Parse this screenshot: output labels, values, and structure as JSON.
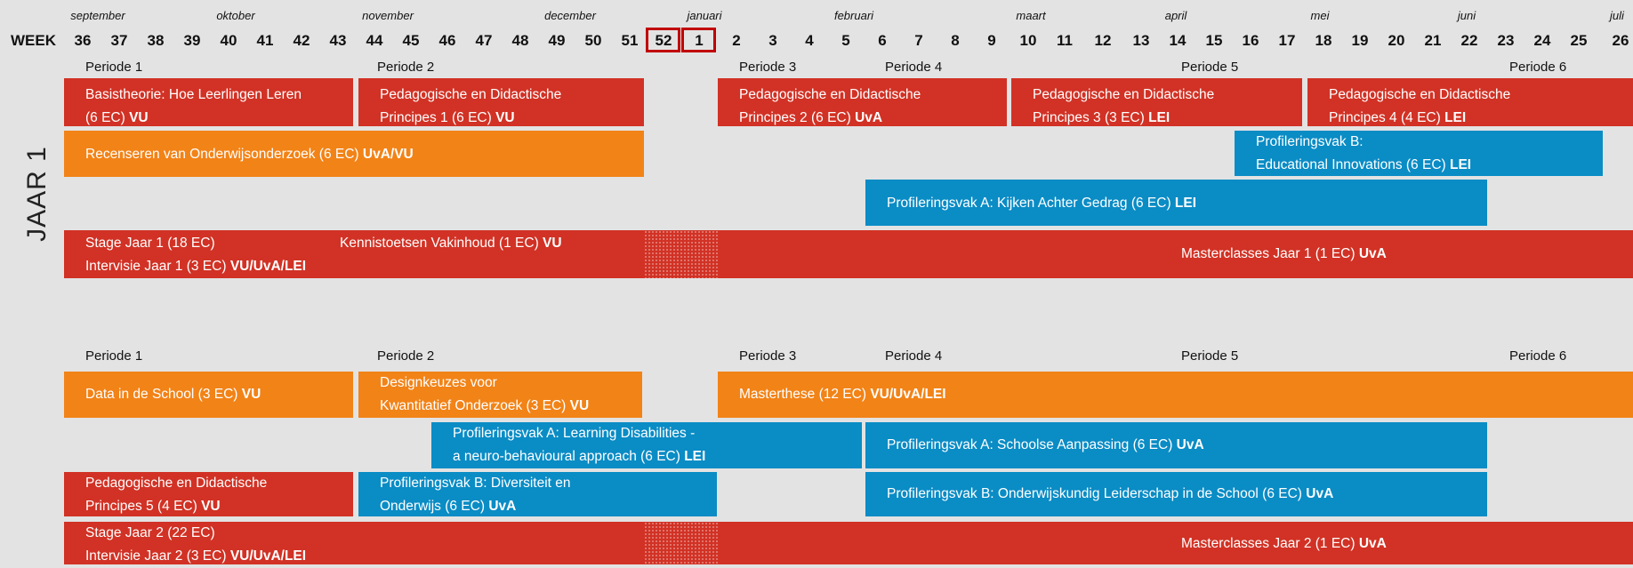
{
  "header": {
    "week_label": "WEEK",
    "months": [
      "september",
      "oktober",
      "november",
      "december",
      "januari",
      "februari",
      "maart",
      "april",
      "mei",
      "juni",
      "juli"
    ],
    "weeks": [
      "36",
      "37",
      "38",
      "39",
      "40",
      "41",
      "42",
      "43",
      "44",
      "45",
      "46",
      "47",
      "48",
      "49",
      "50",
      "51",
      "52",
      "1",
      "2",
      "3",
      "4",
      "5",
      "6",
      "7",
      "8",
      "9",
      "10",
      "11",
      "12",
      "13",
      "14",
      "15",
      "16",
      "17",
      "18",
      "19",
      "20",
      "21",
      "22",
      "23",
      "24",
      "25",
      "26"
    ],
    "highlighted_weeks": [
      "52",
      "1"
    ]
  },
  "year1": {
    "label": "JAAR 1",
    "periods": [
      "Periode 1",
      "Periode 2",
      "Periode 3",
      "Periode 4",
      "Periode 5",
      "Periode 6"
    ],
    "courses": {
      "basistheorie": {
        "line1": "Basistheorie: Hoe Leerlingen Leren",
        "line2": "(6 EC) ",
        "inst": "VU"
      },
      "pedagogische1": {
        "line1": "Pedagogische en Didactische",
        "line2": "Principes 1 (6 EC) ",
        "inst": "VU"
      },
      "pedagogische2": {
        "line1": "Pedagogische en Didactische",
        "line2": "Principes 2 (6 EC) ",
        "inst": "UvA"
      },
      "pedagogische3": {
        "line1": "Pedagogische en Didactische",
        "line2": "Principes 3 (3 EC) ",
        "inst": "LEI"
      },
      "pedagogische4": {
        "line1": "Pedagogische en Didactische",
        "line2": "Principes 4 (4 EC) ",
        "inst": "LEI"
      },
      "recenseren": {
        "line1": "Recenseren van Onderwijsonderzoek (6 EC) ",
        "inst": "UvA/VU"
      },
      "profB": {
        "line1": "Profileringsvak B:",
        "line2": "Educational Innovations (6 EC) ",
        "inst": "LEI"
      },
      "profA": {
        "line1": "Profileringsvak A: Kijken Achter Gedrag (6 EC) ",
        "inst": "LEI"
      },
      "stage": {
        "line1": "Stage Jaar 1 (18 EC)",
        "line2": "Intervisie Jaar 1 (3 EC) ",
        "inst": "VU/UvA/LEI"
      },
      "kennistoetsen": {
        "line1": "Kennistoetsen Vakinhoud (1 EC) ",
        "inst": "VU"
      },
      "masterclasses": {
        "line1": "Masterclasses Jaar 1 (1 EC) ",
        "inst": "UvA"
      }
    }
  },
  "year2": {
    "periods": [
      "Periode 1",
      "Periode 2",
      "Periode 3",
      "Periode 4",
      "Periode 5",
      "Periode 6"
    ],
    "courses": {
      "data": {
        "line1": "Data in de School (3 EC) ",
        "inst": "VU"
      },
      "design": {
        "line1": "Designkeuzes voor",
        "line2": "Kwantitatief Onderzoek (3 EC) ",
        "inst": "VU"
      },
      "masterthese": {
        "line1": "Masterthese (12 EC) ",
        "inst": "VU/UvA/LEI"
      },
      "learning": {
        "line1": "Profileringsvak A: Learning Disabilities -",
        "line2": "a neuro-behavioural approach (6 EC) ",
        "inst": "LEI"
      },
      "schoolse": {
        "line1": "Profileringsvak A: Schoolse Aanpassing (6 EC) ",
        "inst": "UvA"
      },
      "pedagogische5": {
        "line1": "Pedagogische en Didactische",
        "line2": "Principes 5 (4 EC) ",
        "inst": "VU"
      },
      "diversiteit": {
        "line1": "Profileringsvak B: Diversiteit en",
        "line2": "Onderwijs (6 EC) ",
        "inst": "UvA"
      },
      "leiderschap": {
        "line1": "Profileringsvak B: Onderwijskundig Leiderschap in de School (6 EC) ",
        "inst": "UvA"
      },
      "stage": {
        "line1": "Stage Jaar 2 (22 EC)",
        "line2": "Intervisie Jaar 2 (3 EC) ",
        "inst": "VU/UvA/LEI"
      },
      "masterclasses": {
        "line1": "Masterclasses Jaar 2 (1 EC) ",
        "inst": "UvA"
      }
    }
  },
  "colors": {
    "red": "#d13225",
    "orange": "#f28317",
    "blue": "#0a8cc5",
    "background": "#e3e3e3",
    "week_highlight": "#c00000"
  }
}
